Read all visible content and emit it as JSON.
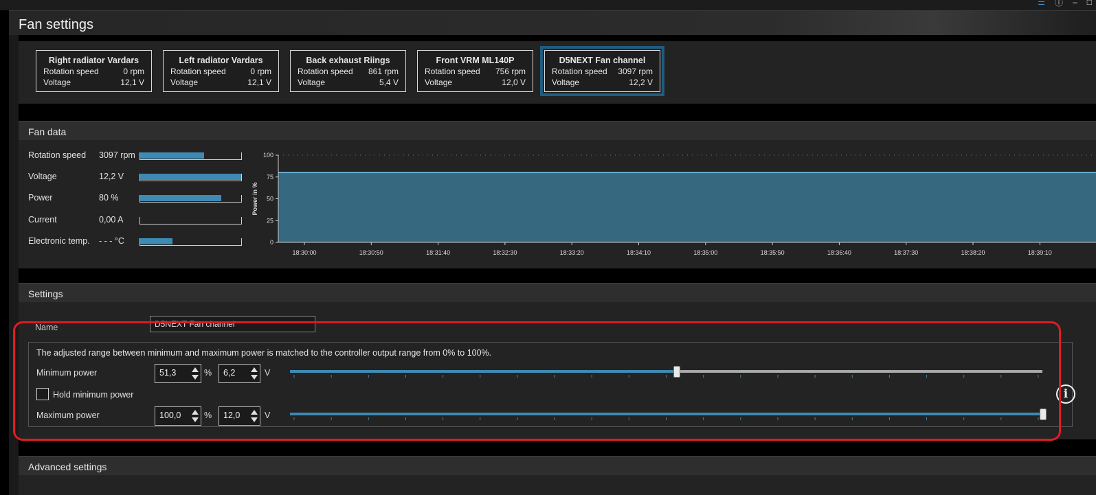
{
  "window": {
    "title": "Fan settings",
    "icons": [
      "layers-icon",
      "info-icon",
      "minimize-icon",
      "maximize-icon"
    ]
  },
  "fans": [
    {
      "name": "Right radiator Vardars",
      "rotation_label": "Rotation speed",
      "rotation": "0 rpm",
      "voltage_label": "Voltage",
      "voltage": "12,1 V",
      "selected": false
    },
    {
      "name": "Left radiator Vardars",
      "rotation_label": "Rotation speed",
      "rotation": "0 rpm",
      "voltage_label": "Voltage",
      "voltage": "12,1 V",
      "selected": false
    },
    {
      "name": "Back exhaust Riings",
      "rotation_label": "Rotation speed",
      "rotation": "861 rpm",
      "voltage_label": "Voltage",
      "voltage": "5,4 V",
      "selected": false
    },
    {
      "name": "Front VRM ML140P",
      "rotation_label": "Rotation speed",
      "rotation": "756 rpm",
      "voltage_label": "Voltage",
      "voltage": "12,0 V",
      "selected": false
    },
    {
      "name": "D5NEXT Fan channel",
      "rotation_label": "Rotation speed",
      "rotation": "3097 rpm",
      "voltage_label": "Voltage",
      "voltage": "12,2 V",
      "selected": true
    }
  ],
  "fan_data": {
    "title": "Fan data",
    "rows": [
      {
        "label": "Rotation speed",
        "value": "3097 rpm",
        "level": 0.63
      },
      {
        "label": "Voltage",
        "value": "12,2 V",
        "level": 1.0
      },
      {
        "label": "Power",
        "value": "80 %",
        "level": 0.8
      },
      {
        "label": "Current",
        "value": "0,00 A",
        "level": 0.0
      },
      {
        "label": "Electronic temp.",
        "value": "- - - °C",
        "level": 0.32
      }
    ]
  },
  "chart_data": {
    "type": "area",
    "ylabel": "Power in %",
    "ylim": [
      0,
      100
    ],
    "yticks": [
      "0",
      "25",
      "50",
      "75",
      "100"
    ],
    "x_tick_labels": [
      "18:30:00",
      "18:30:50",
      "18:31:40",
      "18:32:30",
      "18:33:20",
      "18:34:10",
      "18:35:00",
      "18:35:50",
      "18:36:40",
      "18:37:30",
      "18:38:20",
      "18:39:10"
    ],
    "series": [
      {
        "values": [
          80,
          80
        ]
      }
    ],
    "fill_color": "#36687f",
    "line_color": "#6fc3ec",
    "grid": "dotted top line"
  },
  "settings": {
    "title": "Settings",
    "name_label": "Name",
    "name_value": "D5NEXT Fan channel",
    "range_text": "The adjusted range between minimum and maximum power is matched to the controller output range from 0% to 100%.",
    "min_label": "Minimum power",
    "min_percent": "51,3",
    "min_volt": "6,2",
    "hold_label": "Hold minimum power",
    "max_label": "Maximum power",
    "max_percent": "100,0",
    "max_volt": "12,0",
    "percent_unit": "%",
    "volt_unit": "V",
    "min_slider_level": 0.513,
    "max_slider_level": 1.0
  },
  "advanced": {
    "title": "Advanced settings"
  },
  "colors": {
    "accent": "#3e8ab3",
    "highlight": "#e11b24"
  }
}
